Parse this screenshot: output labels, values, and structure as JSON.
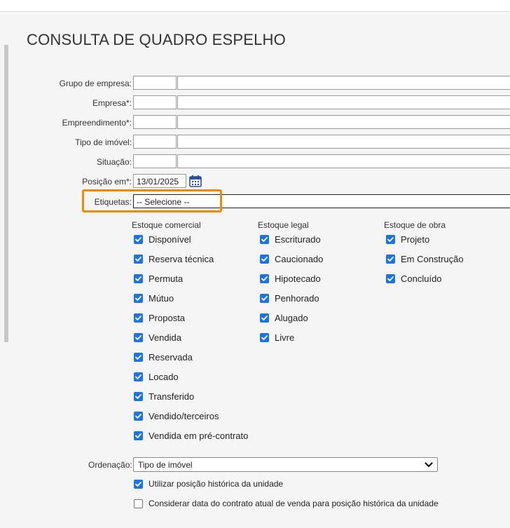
{
  "page": {
    "title": "CONSULTA DE QUADRO ESPELHO"
  },
  "filters": {
    "grupo_empresa": {
      "label": "Grupo de empresa:",
      "code": "",
      "description": ""
    },
    "empresa": {
      "label": "Empresa*:",
      "code": "",
      "description": ""
    },
    "empreendimento": {
      "label": "Empreendimento*:",
      "code": "",
      "description": ""
    },
    "tipo_imovel": {
      "label": "Tipo de imóvel:",
      "code": "",
      "description": ""
    },
    "situacao": {
      "label": "Situação:",
      "code": "",
      "description": ""
    },
    "posicao": {
      "label": "Posição em*:",
      "value": "13/01/2025",
      "icon": "calendar-icon"
    },
    "etiquetas": {
      "label": "Etiquetas:",
      "value": "-- Selecione --"
    }
  },
  "columns": [
    {
      "title": "Estoque comercial",
      "items": [
        {
          "label": "Disponível",
          "checked": true
        },
        {
          "label": "Reserva técnica",
          "checked": true
        },
        {
          "label": "Permuta",
          "checked": true
        },
        {
          "label": "Mútuo",
          "checked": true
        },
        {
          "label": "Proposta",
          "checked": true
        },
        {
          "label": "Vendida",
          "checked": true
        },
        {
          "label": "Reservada",
          "checked": true
        },
        {
          "label": "Locado",
          "checked": true
        },
        {
          "label": "Transferido",
          "checked": true
        },
        {
          "label": "Vendido/terceiros",
          "checked": true
        },
        {
          "label": "Vendida em pré-contrato",
          "checked": true
        }
      ]
    },
    {
      "title": "Estoque legal",
      "items": [
        {
          "label": "Escriturado",
          "checked": true
        },
        {
          "label": "Caucionado",
          "checked": true
        },
        {
          "label": "Hipotecado",
          "checked": true
        },
        {
          "label": "Penhorado",
          "checked": true
        },
        {
          "label": "Alugado",
          "checked": true
        },
        {
          "label": "Livre",
          "checked": true
        }
      ]
    },
    {
      "title": "Estoque de obra",
      "items": [
        {
          "label": "Projeto",
          "checked": true
        },
        {
          "label": "Em Construção",
          "checked": true
        },
        {
          "label": "Concluído",
          "checked": true
        }
      ]
    }
  ],
  "ordenacao": {
    "label": "Ordenação:",
    "value": "Tipo de imóvel"
  },
  "options": {
    "historica": {
      "label": "Utilizar posição histórica da unidade",
      "checked": true
    },
    "contrato": {
      "label": "Considerar data do contrato atual de venda para posição histórica da unidade",
      "checked": false
    }
  },
  "colors": {
    "accent": "#1a73e8",
    "highlight": "#f08a00"
  }
}
